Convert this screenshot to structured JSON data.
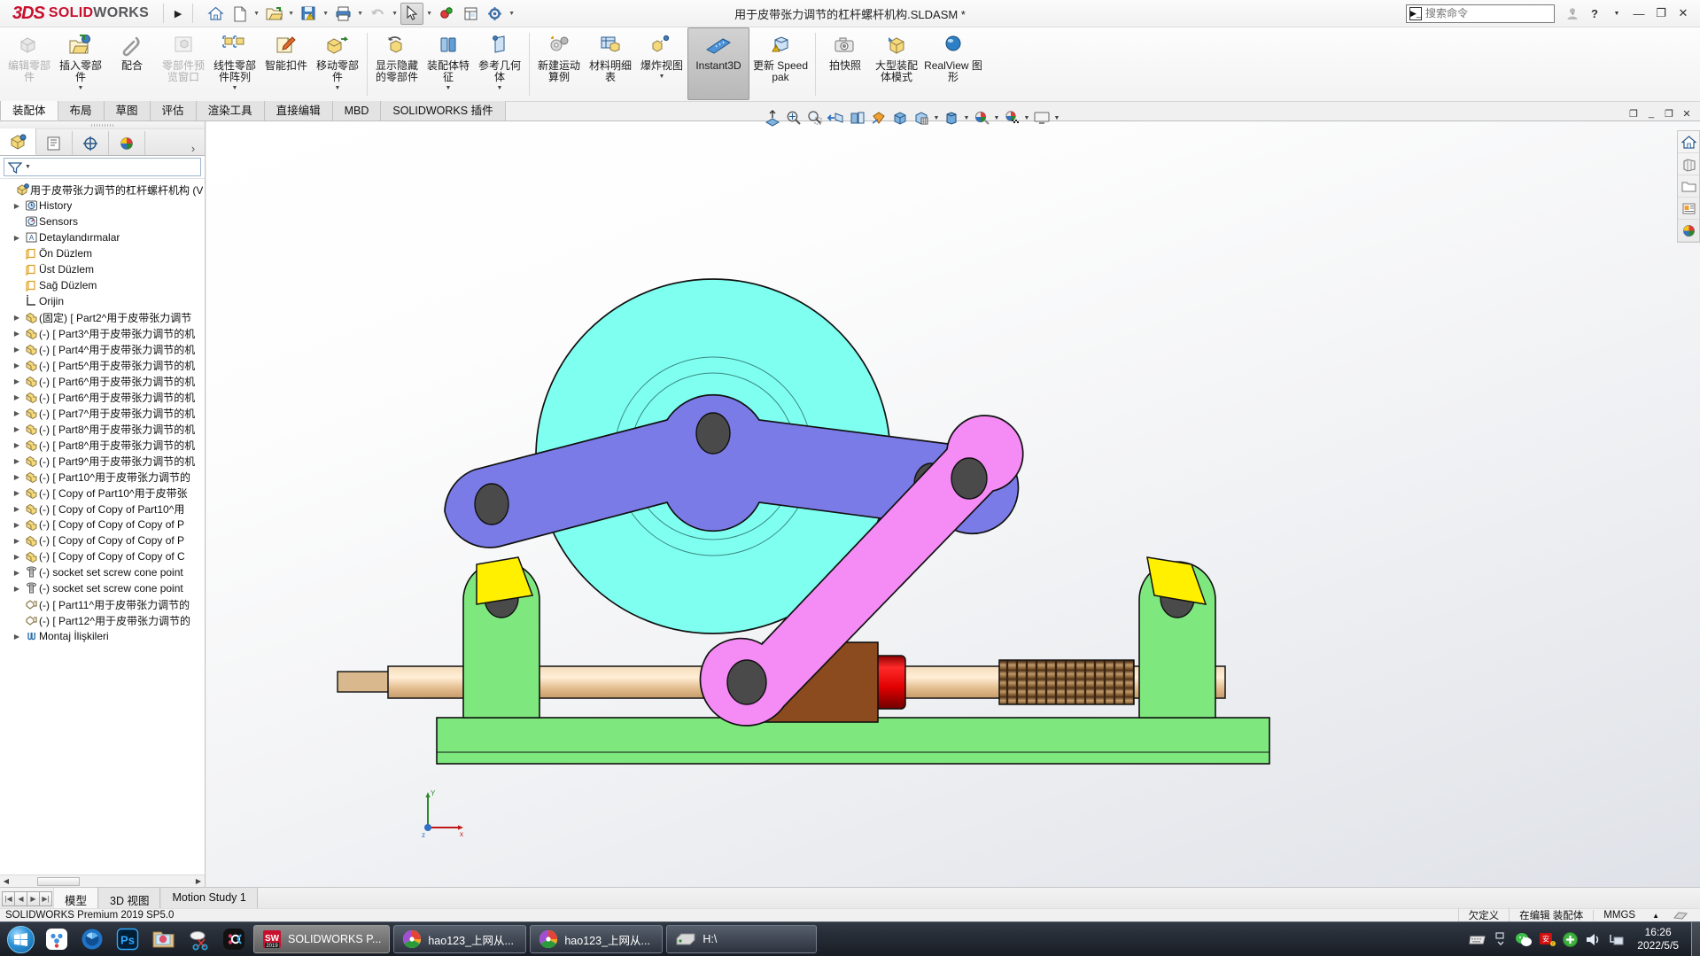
{
  "title_bar": {
    "brand_3ds": "3DS",
    "brand_solid": "SOLID",
    "brand_works": "WORKS",
    "document_title": "用于皮带张力调节的杠杆螺杆机构.SLDASM *",
    "search_placeholder": "搜索命令",
    "quick_access": [
      {
        "name": "home-icon",
        "label": "主页"
      },
      {
        "name": "new-document-icon",
        "label": "新建"
      },
      {
        "name": "open-folder-icon",
        "label": "打开"
      },
      {
        "name": "save-icon",
        "label": "保存"
      },
      {
        "name": "print-icon",
        "label": "打印"
      },
      {
        "name": "undo-icon",
        "label": "撤消"
      },
      {
        "name": "select-cursor-icon",
        "label": "选择"
      },
      {
        "name": "rebuild-icon",
        "label": "重建模型"
      },
      {
        "name": "drawing-sheet-icon",
        "label": "工程图"
      },
      {
        "name": "options-gear-icon",
        "label": "选项"
      }
    ],
    "window_controls": {
      "user": "用户",
      "help": "?",
      "minimize": "—",
      "restore": "❐",
      "close": "✕"
    }
  },
  "ribbon": {
    "groups": [
      {
        "commands": [
          {
            "label": "编辑零部件",
            "icon": "edit-component-icon",
            "disabled": true,
            "dropdown": false
          },
          {
            "label": "插入零部件",
            "icon": "insert-component-icon",
            "disabled": false,
            "dropdown": true
          },
          {
            "label": "配合",
            "icon": "mate-paperclip-icon",
            "disabled": false,
            "dropdown": false
          },
          {
            "label": "零部件预览窗口",
            "icon": "component-preview-icon",
            "disabled": true,
            "dropdown": false
          },
          {
            "label": "线性零部件阵列",
            "icon": "linear-pattern-icon",
            "disabled": false,
            "dropdown": true
          },
          {
            "label": "智能扣件",
            "icon": "smart-fastener-icon",
            "disabled": false,
            "dropdown": false
          },
          {
            "label": "移动零部件",
            "icon": "move-component-icon",
            "disabled": false,
            "dropdown": true
          }
        ]
      },
      {
        "commands": [
          {
            "label": "显示隐藏的零部件",
            "icon": "show-hidden-components-icon",
            "disabled": false,
            "dropdown": false
          },
          {
            "label": "装配体特征",
            "icon": "assembly-feature-icon",
            "disabled": false,
            "dropdown": true
          },
          {
            "label": "参考几何体",
            "icon": "reference-geometry-icon",
            "disabled": false,
            "dropdown": true
          }
        ]
      },
      {
        "commands": [
          {
            "label": "新建运动算例",
            "icon": "new-motion-study-icon",
            "disabled": false,
            "dropdown": false
          },
          {
            "label": "材料明细表",
            "icon": "bill-of-materials-icon",
            "disabled": false,
            "dropdown": false
          },
          {
            "label": "爆炸视图",
            "icon": "exploded-view-icon",
            "disabled": false,
            "dropdown": true
          },
          {
            "label": "Instant3D",
            "icon": "instant3d-icon",
            "disabled": false,
            "active": true,
            "dropdown": false
          },
          {
            "label": "更新 Speedpak",
            "icon": "update-speedpak-icon",
            "disabled": false,
            "dropdown": false
          }
        ]
      },
      {
        "commands": [
          {
            "label": "拍快照",
            "icon": "take-snapshot-icon",
            "disabled": false,
            "dropdown": false
          },
          {
            "label": "大型装配体模式",
            "icon": "large-assembly-mode-icon",
            "disabled": false,
            "dropdown": false
          },
          {
            "label": "RealView 图形",
            "icon": "realview-graphics-icon",
            "disabled": false,
            "dropdown": false
          }
        ]
      }
    ]
  },
  "command_tabs": [
    {
      "label": "装配体",
      "selected": true
    },
    {
      "label": "布局",
      "selected": false
    },
    {
      "label": "草图",
      "selected": false
    },
    {
      "label": "评估",
      "selected": false
    },
    {
      "label": "渲染工具",
      "selected": false
    },
    {
      "label": "直接编辑",
      "selected": false
    },
    {
      "label": "MBD",
      "selected": false
    },
    {
      "label": "SOLIDWORKS 插件",
      "selected": false
    }
  ],
  "view_toolbar": [
    {
      "name": "zoom-to-fit-icon",
      "label": "整屏显示全图",
      "caret": false
    },
    {
      "name": "zoom-to-area-icon",
      "label": "局部放大",
      "caret": false
    },
    {
      "name": "zoom-in-out-icon",
      "label": "放大缩小",
      "caret": false
    },
    {
      "name": "previous-view-icon",
      "label": "上一视图",
      "caret": false
    },
    {
      "name": "section-view-icon",
      "label": "剖面视图",
      "caret": false
    },
    {
      "name": "view-orientation-icon",
      "label": "视图定向",
      "caret": false
    },
    {
      "name": "isometric-view-icon",
      "label": "等轴测",
      "caret": false
    },
    {
      "name": "display-style-icon",
      "label": "显示样式",
      "caret": true
    },
    {
      "name": "hide-show-items-icon",
      "label": "隐藏/显示项目",
      "caret": true
    },
    {
      "name": "edit-appearance-icon",
      "label": "编辑外观",
      "caret": true
    },
    {
      "name": "apply-scene-icon",
      "label": "应用布景",
      "caret": true
    },
    {
      "name": "view-settings-icon",
      "label": "视图设定",
      "caret": true
    }
  ],
  "left_panel": {
    "tabs": [
      {
        "name": "feature-manager-tab",
        "label": "FeatureManager 设计树",
        "selected": true
      },
      {
        "name": "property-manager-tab",
        "label": "PropertyManager",
        "selected": false
      },
      {
        "name": "configuration-manager-tab",
        "label": "ConfigurationManager",
        "selected": false
      },
      {
        "name": "display-manager-tab",
        "label": "DisplayManager",
        "selected": false
      }
    ],
    "more_label": "›",
    "filter_placeholder": "",
    "tree": [
      {
        "label": "用于皮带张力调节的杠杆螺杆机构  (V",
        "icon": "assembly-icon",
        "indent": 0,
        "arrow": false
      },
      {
        "label": "History",
        "icon": "history-folder-icon",
        "indent": 1,
        "arrow": true
      },
      {
        "label": "Sensors",
        "icon": "sensors-icon",
        "indent": 1,
        "arrow": false
      },
      {
        "label": "Detaylandırmalar",
        "icon": "annotations-icon",
        "indent": 1,
        "arrow": true
      },
      {
        "label": "Ön Düzlem",
        "icon": "plane-icon",
        "indent": 1,
        "arrow": false
      },
      {
        "label": "Üst Düzlem",
        "icon": "plane-icon",
        "indent": 1,
        "arrow": false
      },
      {
        "label": "Sağ Düzlem",
        "icon": "plane-icon",
        "indent": 1,
        "arrow": false
      },
      {
        "label": "Orijin",
        "icon": "origin-icon",
        "indent": 1,
        "arrow": false
      },
      {
        "label": "(固定) [ Part2^用于皮带张力调节",
        "icon": "part-icon",
        "indent": 1,
        "arrow": true
      },
      {
        "label": "(-) [ Part3^用于皮带张力调节的机",
        "icon": "part-icon",
        "indent": 1,
        "arrow": true
      },
      {
        "label": "(-) [ Part4^用于皮带张力调节的机",
        "icon": "part-icon",
        "indent": 1,
        "arrow": true
      },
      {
        "label": "(-) [ Part5^用于皮带张力调节的机",
        "icon": "part-icon",
        "indent": 1,
        "arrow": true
      },
      {
        "label": "(-) [ Part6^用于皮带张力调节的机",
        "icon": "part-icon",
        "indent": 1,
        "arrow": true
      },
      {
        "label": "(-) [ Part6^用于皮带张力调节的机",
        "icon": "part-icon",
        "indent": 1,
        "arrow": true
      },
      {
        "label": "(-) [ Part7^用于皮带张力调节的机",
        "icon": "part-icon",
        "indent": 1,
        "arrow": true
      },
      {
        "label": "(-) [ Part8^用于皮带张力调节的机",
        "icon": "part-icon",
        "indent": 1,
        "arrow": true
      },
      {
        "label": "(-) [ Part8^用于皮带张力调节的机",
        "icon": "part-icon",
        "indent": 1,
        "arrow": true
      },
      {
        "label": "(-) [ Part9^用于皮带张力调节的机",
        "icon": "part-icon",
        "indent": 1,
        "arrow": true
      },
      {
        "label": "(-) [ Part10^用于皮带张力调节的",
        "icon": "part-icon",
        "indent": 1,
        "arrow": true
      },
      {
        "label": "(-) [ Copy of Part10^用于皮带张",
        "icon": "part-icon",
        "indent": 1,
        "arrow": true
      },
      {
        "label": "(-) [ Copy of Copy of Part10^用",
        "icon": "part-icon",
        "indent": 1,
        "arrow": true
      },
      {
        "label": "(-) [ Copy of Copy of Copy of P",
        "icon": "part-icon",
        "indent": 1,
        "arrow": true
      },
      {
        "label": "(-) [ Copy of Copy of Copy of P",
        "icon": "part-icon",
        "indent": 1,
        "arrow": true
      },
      {
        "label": "(-) [ Copy of Copy of Copy of C",
        "icon": "part-icon",
        "indent": 1,
        "arrow": true
      },
      {
        "label": "(-) socket set screw cone point",
        "icon": "screw-icon",
        "indent": 1,
        "arrow": true
      },
      {
        "label": "(-) socket set screw cone point",
        "icon": "screw-icon",
        "indent": 1,
        "arrow": true
      },
      {
        "label": "(-) [ Part11^用于皮带张力调节的",
        "icon": "surface-part-icon",
        "indent": 1,
        "arrow": false
      },
      {
        "label": "(-) [ Part12^用于皮带张力调节的",
        "icon": "surface-part-icon",
        "indent": 1,
        "arrow": false
      },
      {
        "label": "Montaj İlişkileri",
        "icon": "mates-icon",
        "indent": 1,
        "arrow": true
      }
    ]
  },
  "viewport": {
    "triad": {
      "x_label": "x",
      "y_label": "Y",
      "z_label": "z"
    },
    "right_toolbar": [
      {
        "name": "view-home-icon",
        "label": "主页"
      },
      {
        "name": "appearances-icon",
        "label": "外观"
      },
      {
        "name": "open-library-folder-icon",
        "label": "设计库"
      },
      {
        "name": "custom-properties-icon",
        "label": "自定义属性"
      },
      {
        "name": "appearance-sphere-icon",
        "label": "外观/布景"
      }
    ],
    "doc_window_buttons": [
      {
        "name": "restore-doc-icon",
        "label": "❐"
      },
      {
        "name": "minimize-doc-icon",
        "label": "_"
      },
      {
        "name": "maximize-doc-icon",
        "label": "❐"
      },
      {
        "name": "close-doc-icon",
        "label": "✕"
      }
    ],
    "model_colors": {
      "flywheel_cyan": "#7FFFF0",
      "lever_purple": "#7B7BE8",
      "link_magenta": "#F58BF5",
      "bracket_green": "#7EE87E",
      "wedge_yellow": "#FFF000",
      "block_brown": "#8C4B1E",
      "collar_red": "#EE1111",
      "shaft_tan": "#E8C49A",
      "pin_gray": "#4A4A4A"
    }
  },
  "bottom_tabs": [
    {
      "label": "模型",
      "selected": true
    },
    {
      "label": "3D 视图",
      "selected": false
    },
    {
      "label": "Motion Study 1",
      "selected": false
    }
  ],
  "status_bar": {
    "left": "SOLIDWORKS Premium 2019 SP5.0",
    "underdefined": "欠定义",
    "editing": "在编辑 装配体",
    "units": "MMGS",
    "units_caret": "▲"
  },
  "taskbar": {
    "pinned": [
      {
        "name": "baidu-netdisk-icon",
        "label": "百度网盘"
      },
      {
        "name": "camera-aperture-icon",
        "label": "相机"
      },
      {
        "name": "photoshop-icon",
        "label": "Ps"
      },
      {
        "name": "photo-folder-icon",
        "label": "图片"
      },
      {
        "name": "snipping-tool-icon",
        "label": "截图工具"
      },
      {
        "name": "ok-app-icon",
        "label": "OK"
      }
    ],
    "windows": [
      {
        "label": "SOLIDWORKS P...",
        "icon": "solidworks-app-icon",
        "active": true,
        "badge": "2019"
      },
      {
        "label": "hao123_上网从...",
        "icon": "hao123-icon",
        "active": false
      },
      {
        "label": "hao123_上网从...",
        "icon": "hao123-icon",
        "active": false
      },
      {
        "label": "H:\\",
        "icon": "drive-icon",
        "active": false
      }
    ],
    "tray": [
      {
        "name": "keyboard-icon",
        "label": "输入法"
      },
      {
        "name": "show-hidden-icons-icon",
        "label": "显示隐藏的图标"
      },
      {
        "name": "wechat-icon",
        "label": "微信"
      },
      {
        "name": "antivirus-icon",
        "label": "杀毒"
      },
      {
        "name": "update-icon",
        "label": "更新"
      },
      {
        "name": "volume-icon",
        "label": "音量"
      },
      {
        "name": "network-icon",
        "label": "网络"
      }
    ],
    "clock_time": "16:26",
    "clock_date": "2022/5/5"
  }
}
